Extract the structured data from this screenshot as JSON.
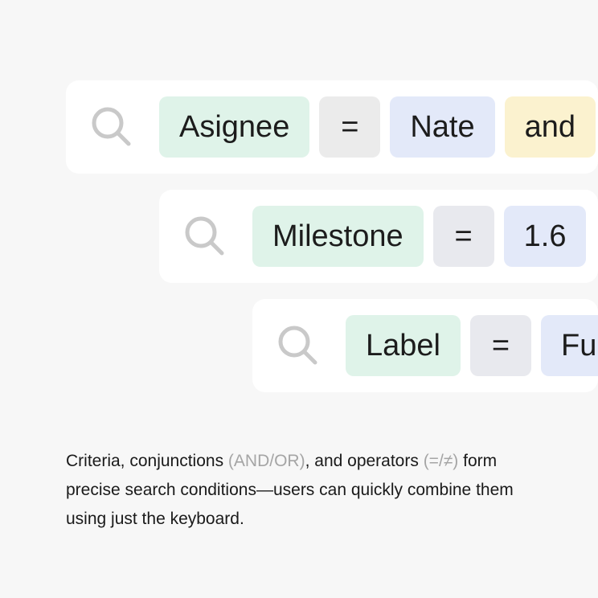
{
  "rows": [
    {
      "criteria": "Asignee",
      "operator": "=",
      "value": "Nate",
      "conjunction": "and"
    },
    {
      "criteria": "Milestone",
      "operator": "=",
      "value": "1.6"
    },
    {
      "criteria": "Label",
      "operator": "=",
      "value": "Fu"
    }
  ],
  "caption": {
    "part1": "Criteria, conjunctions ",
    "conjunctions_hint": "(AND/OR)",
    "part2": ", and operators ",
    "operators_hint": "(=/≠)",
    "part3": " form precise search conditions—users can quickly combine them using just the keyboard."
  },
  "colors": {
    "background": "#f7f7f7",
    "bar": "#ffffff",
    "criteria_chip": "#dff3e9",
    "operator_chip": "#e8e9ee",
    "value_chip": "#e3e9f9",
    "conjunction_chip": "#fbf2cf",
    "icon": "#c9c9c9",
    "muted_text": "#a5a5a5"
  },
  "icons": {
    "search": "search-icon"
  }
}
